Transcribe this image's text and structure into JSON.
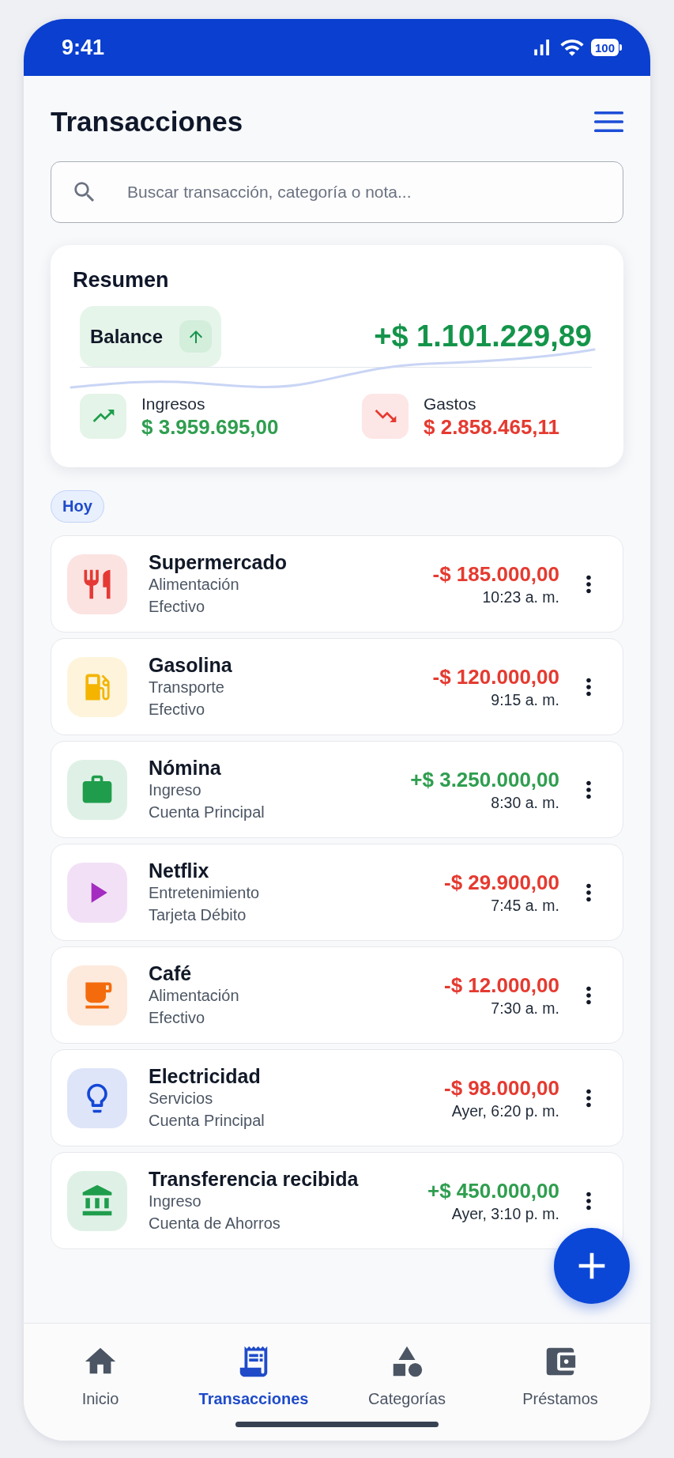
{
  "status_bar": {
    "time": "9:41",
    "battery": "100"
  },
  "header": {
    "title": "Transacciones"
  },
  "search": {
    "placeholder": "Buscar transacción, categoría o nota..."
  },
  "summary": {
    "title": "Resumen",
    "balance": {
      "label": "Balance",
      "amount": "+$ 1.101.229,89"
    },
    "income": {
      "label": "Ingresos",
      "amount": "$ 3.959.695,00"
    },
    "expenses": {
      "label": "Gastos",
      "amount": "$ 2.858.465,11"
    }
  },
  "section": {
    "label": "Hoy"
  },
  "transactions": [
    {
      "title": "Supermercado",
      "category": "Alimentación",
      "account": "Efectivo",
      "amount": "-$ 185.000,00",
      "time": "10:23 a. m.",
      "positive": false,
      "color": "#e53935"
    },
    {
      "title": "Gasolina",
      "category": "Transporte",
      "account": "Efectivo",
      "amount": "-$ 120.000,00",
      "time": "9:15 a. m.",
      "positive": false,
      "color": "#f4b400"
    },
    {
      "title": "Nómina",
      "category": "Ingreso",
      "account": "Cuenta Principal",
      "amount": "+$ 3.250.000,00",
      "time": "8:30 a. m.",
      "positive": true,
      "color": "#1f9d4c"
    },
    {
      "title": "Netflix",
      "category": "Entretenimiento",
      "account": "Tarjeta Débito",
      "amount": "-$ 29.900,00",
      "time": "7:45 a. m.",
      "positive": false,
      "color": "#a42cc0"
    },
    {
      "title": "Café",
      "category": "Alimentación",
      "account": "Efectivo",
      "amount": "-$ 12.000,00",
      "time": "7:30 a. m.",
      "positive": false,
      "color": "#f46b0d"
    },
    {
      "title": "Electricidad",
      "category": "Servicios",
      "account": "Cuenta Principal",
      "amount": "-$ 98.000,00",
      "time": "Ayer, 6:20 p. m.",
      "positive": false,
      "color": "#1447d6"
    },
    {
      "title": "Transferencia recibida",
      "category": "Ingreso",
      "account": "Cuenta de Ahorros",
      "amount": "+$ 450.000,00",
      "time": "Ayer, 3:10 p. m.",
      "positive": true,
      "color": "#1f9d4c"
    }
  ],
  "nav": {
    "items": [
      {
        "label": "Inicio",
        "selected": false
      },
      {
        "label": "Transacciones",
        "selected": true
      },
      {
        "label": "Categorías",
        "selected": false
      },
      {
        "label": "Préstamos",
        "selected": false
      }
    ]
  }
}
